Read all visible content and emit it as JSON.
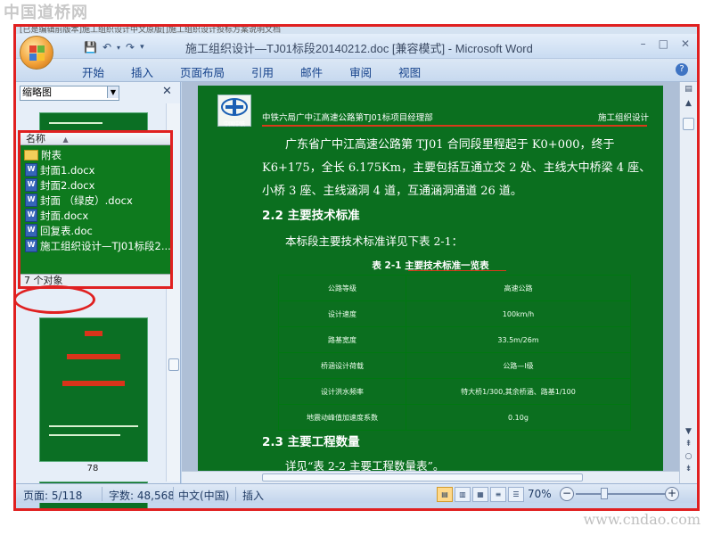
{
  "watermark": {
    "top": "中国道桥网",
    "bottom": "www.cndao.com"
  },
  "behind_window_text": "[已是编辑前版本]施工组织设计中文原版[]施工组织设计投标方案说明文档",
  "window": {
    "title": "施工组织设计—TJ01标段20140212.doc [兼容模式] - Microsoft Word",
    "controls": [
      "–",
      "□",
      "✕"
    ]
  },
  "ribbon": {
    "tabs": [
      "开始",
      "插入",
      "页面布局",
      "引用",
      "邮件",
      "审阅",
      "视图"
    ],
    "help": "?"
  },
  "nav_pane": {
    "mode": "缩略图",
    "close": "✕",
    "page_number": "78"
  },
  "file_view": {
    "column_header": "名称",
    "sort_arrow": "▲",
    "items": [
      {
        "name": "附表",
        "type": "folder"
      },
      {
        "name": "封面1.docx",
        "type": "doc"
      },
      {
        "name": "封面2.docx",
        "type": "doc"
      },
      {
        "name": "封面 （绿皮）.docx",
        "type": "doc"
      },
      {
        "name": "封面.docx",
        "type": "doc"
      },
      {
        "name": "回复表.doc",
        "type": "doc"
      },
      {
        "name": "施工组织设计—TJ01标段2...",
        "type": "doc"
      }
    ],
    "status": "7 个对象"
  },
  "document": {
    "header_left": "中铁六局广中江高速公路第TJ01标项目经理部",
    "header_right": "施工组织设计",
    "logo_text": "中国中铁",
    "para1": "广东省广中江高速公路第 TJ01 合同段里程起于 K0+000，终于 K6+175，全长 6.175Km，主要包括互通立交 2 处、主线大中桥梁 4 座、小桥 3 座、主线涵洞 4 道，互通涵洞通道 26 道。",
    "section_2_2": "2.2 主要技术标准",
    "para2": "本标段主要技术标准详见下表 2-1：",
    "table_caption": "表 2-1  主要技术标准一览表",
    "table_rows": [
      {
        "k": "公路等级",
        "v": "高速公路"
      },
      {
        "k": "设计速度",
        "v": "100km/h"
      },
      {
        "k": "路基宽度",
        "v": "33.5m/26m"
      },
      {
        "k": "桥涵设计荷载",
        "v": "公路—I级"
      },
      {
        "k": "设计洪水频率",
        "v": "特大桥1/300,其余桥涵、路基1/100"
      },
      {
        "k": "地震动峰值加速度系数",
        "v": "0.10g"
      }
    ],
    "section_2_3": "2.3 主要工程数量",
    "para3": "详见“表 2-2 主要工程数量表”。",
    "para_mark": "↵"
  },
  "statusbar": {
    "page": "页面: 5/118",
    "words": "字数: 48,568",
    "language": "中文(中国)",
    "mode": "插入",
    "zoom": "70%"
  }
}
